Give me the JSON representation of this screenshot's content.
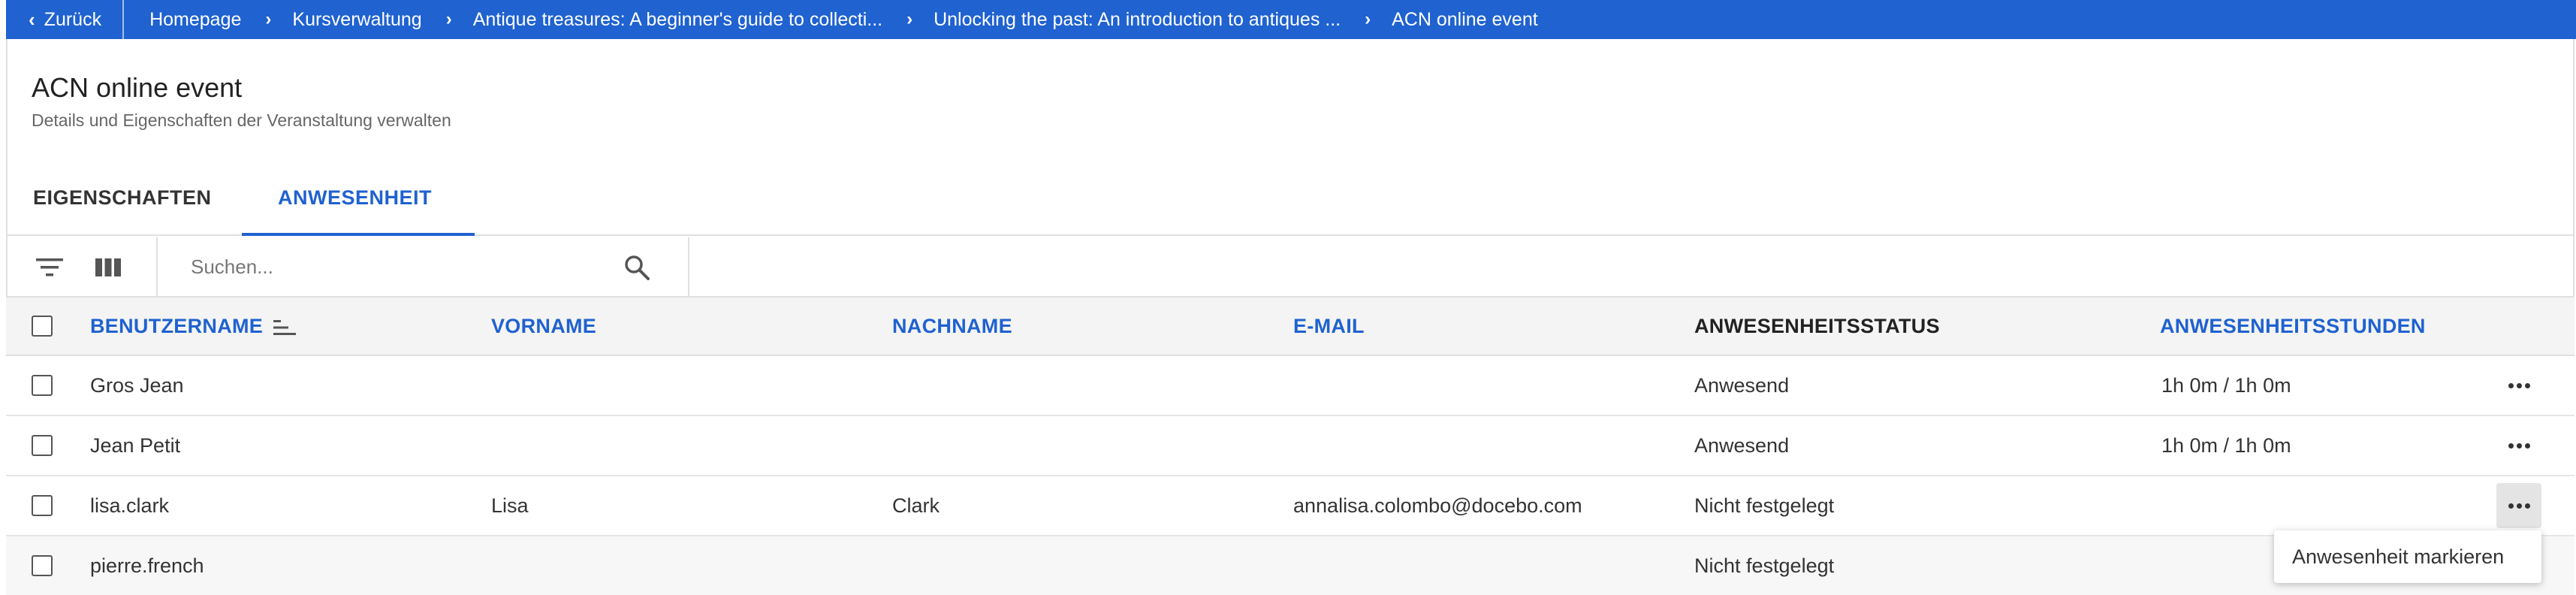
{
  "breadcrumb": {
    "back_label": "Zurück",
    "items": [
      "Homepage",
      "Kursverwaltung",
      "Antique treasures: A beginner's guide to collecti...",
      "Unlocking the past: An introduction to antiques ...",
      "ACN online event"
    ]
  },
  "page": {
    "title": "ACN online event",
    "subtitle": "Details und Eigenschaften der Veranstaltung verwalten"
  },
  "tabs": [
    {
      "label": "EIGENSCHAFTEN",
      "active": false
    },
    {
      "label": "ANWESENHEIT",
      "active": true
    }
  ],
  "toolbar": {
    "search_placeholder": "Suchen..."
  },
  "table": {
    "columns": [
      "BENUTZERNAME",
      "VORNAME",
      "NACHNAME",
      "E-MAIL",
      "ANWESENHEITSSTATUS",
      "ANWESENHEITSSTUNDEN"
    ],
    "rows": [
      {
        "username": "Gros Jean",
        "first": "",
        "last": "",
        "email": "",
        "status": "Anwesend",
        "hours": "1h 0m / 1h 0m"
      },
      {
        "username": "Jean Petit",
        "first": "",
        "last": "",
        "email": "",
        "status": "Anwesend",
        "hours": "1h 0m / 1h 0m"
      },
      {
        "username": "lisa.clark",
        "first": "Lisa",
        "last": "Clark",
        "email": "annalisa.colombo@docebo.com",
        "status": "Nicht festgelegt",
        "hours": ""
      },
      {
        "username": "pierre.french",
        "first": "",
        "last": "",
        "email": "",
        "status": "Nicht festgelegt",
        "hours": ""
      }
    ]
  },
  "menu": {
    "item_label": "Anwesenheit markieren"
  },
  "colors": {
    "accent": "#1f62d0",
    "header_bg": "#f4f4f4"
  },
  "icons": [
    "chevron-left-icon",
    "chevron-right-icon",
    "filter-icon",
    "columns-icon",
    "search-icon",
    "sort-icon",
    "more-icon"
  ]
}
